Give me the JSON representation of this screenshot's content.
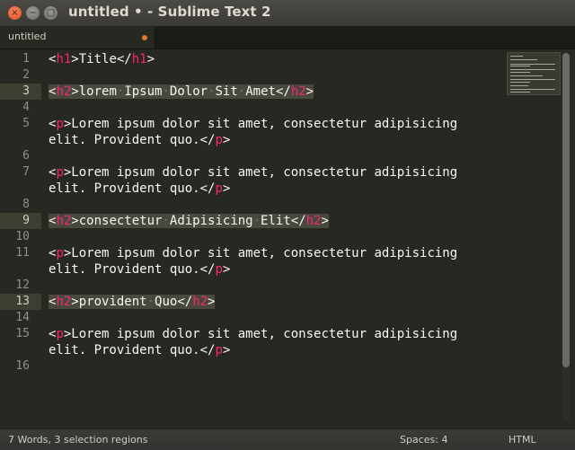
{
  "window": {
    "title": "untitled • - Sublime Text 2",
    "close_glyph": "×",
    "min_glyph": "−",
    "max_glyph": "□"
  },
  "tab": {
    "label": "untitled",
    "dirty": true
  },
  "lines": [
    {
      "n": "1",
      "parts": [
        [
          "ang",
          "<"
        ],
        [
          "tag",
          "h1"
        ],
        [
          "ang",
          ">Title</"
        ],
        [
          "tag",
          "h1"
        ],
        [
          "ang",
          ">"
        ]
      ]
    },
    {
      "n": "2",
      "parts": []
    },
    {
      "n": "3",
      "hl": true,
      "parts": [
        [
          "ang",
          "<"
        ],
        [
          "tag",
          "h2"
        ],
        [
          "ang",
          ">lorem"
        ],
        [
          "dot",
          "·"
        ],
        [
          "ang",
          "Ipsum"
        ],
        [
          "dot",
          "·"
        ],
        [
          "ang",
          "Dolor"
        ],
        [
          "dot",
          "·"
        ],
        [
          "ang",
          "Sit"
        ],
        [
          "dot",
          "·"
        ],
        [
          "ang",
          "Amet</"
        ],
        [
          "tag",
          "h2"
        ],
        [
          "ang",
          ">"
        ]
      ]
    },
    {
      "n": "4",
      "parts": []
    },
    {
      "n": "5",
      "parts": [
        [
          "ang",
          "<"
        ],
        [
          "tag",
          "p"
        ],
        [
          "ang",
          ">Lorem ipsum dolor sit amet, consectetur adipisicing"
        ]
      ]
    },
    {
      "n": "",
      "parts": [
        [
          "ang",
          "elit. Provident quo.</"
        ],
        [
          "tag",
          "p"
        ],
        [
          "ang",
          ">"
        ]
      ]
    },
    {
      "n": "6",
      "parts": []
    },
    {
      "n": "7",
      "parts": [
        [
          "ang",
          "<"
        ],
        [
          "tag",
          "p"
        ],
        [
          "ang",
          ">Lorem ipsum dolor sit amet, consectetur adipisicing"
        ]
      ]
    },
    {
      "n": "",
      "parts": [
        [
          "ang",
          "elit. Provident quo.</"
        ],
        [
          "tag",
          "p"
        ],
        [
          "ang",
          ">"
        ]
      ]
    },
    {
      "n": "8",
      "parts": []
    },
    {
      "n": "9",
      "hl": true,
      "parts": [
        [
          "ang",
          "<"
        ],
        [
          "tag",
          "h2"
        ],
        [
          "ang",
          ">consectetur"
        ],
        [
          "dot",
          "·"
        ],
        [
          "ang",
          "Adipisicing"
        ],
        [
          "dot",
          "·"
        ],
        [
          "ang",
          "Elit</"
        ],
        [
          "tag",
          "h2"
        ],
        [
          "ang",
          ">"
        ]
      ]
    },
    {
      "n": "10",
      "parts": []
    },
    {
      "n": "11",
      "parts": [
        [
          "ang",
          "<"
        ],
        [
          "tag",
          "p"
        ],
        [
          "ang",
          ">Lorem ipsum dolor sit amet, consectetur adipisicing"
        ]
      ]
    },
    {
      "n": "",
      "parts": [
        [
          "ang",
          "elit. Provident quo.</"
        ],
        [
          "tag",
          "p"
        ],
        [
          "ang",
          ">"
        ]
      ]
    },
    {
      "n": "12",
      "parts": []
    },
    {
      "n": "13",
      "hl": true,
      "parts": [
        [
          "ang",
          "<"
        ],
        [
          "tag",
          "h2"
        ],
        [
          "ang",
          ">provident"
        ],
        [
          "dot",
          "·"
        ],
        [
          "ang",
          "Quo</"
        ],
        [
          "tag",
          "h2"
        ],
        [
          "ang",
          ">"
        ]
      ]
    },
    {
      "n": "14",
      "parts": []
    },
    {
      "n": "15",
      "parts": [
        [
          "ang",
          "<"
        ],
        [
          "tag",
          "p"
        ],
        [
          "ang",
          ">Lorem ipsum dolor sit amet, consectetur adipisicing"
        ]
      ]
    },
    {
      "n": "",
      "parts": [
        [
          "ang",
          "elit. Provident quo.</"
        ],
        [
          "tag",
          "p"
        ],
        [
          "ang",
          ">"
        ]
      ]
    },
    {
      "n": "16",
      "parts": []
    }
  ],
  "status": {
    "left": "7 Words, 3 selection regions",
    "spaces": "Spaces: 4",
    "syntax": "HTML"
  },
  "colors": {
    "background": "#272822",
    "tag": "#f92672",
    "text": "#f8f8f2",
    "selection": "#49483e",
    "dirty_indicator": "#e0782f",
    "close_button": "#e0531f"
  },
  "icons": [
    "close-icon",
    "minimize-icon",
    "maximize-icon",
    "unsaved-dot-icon"
  ]
}
